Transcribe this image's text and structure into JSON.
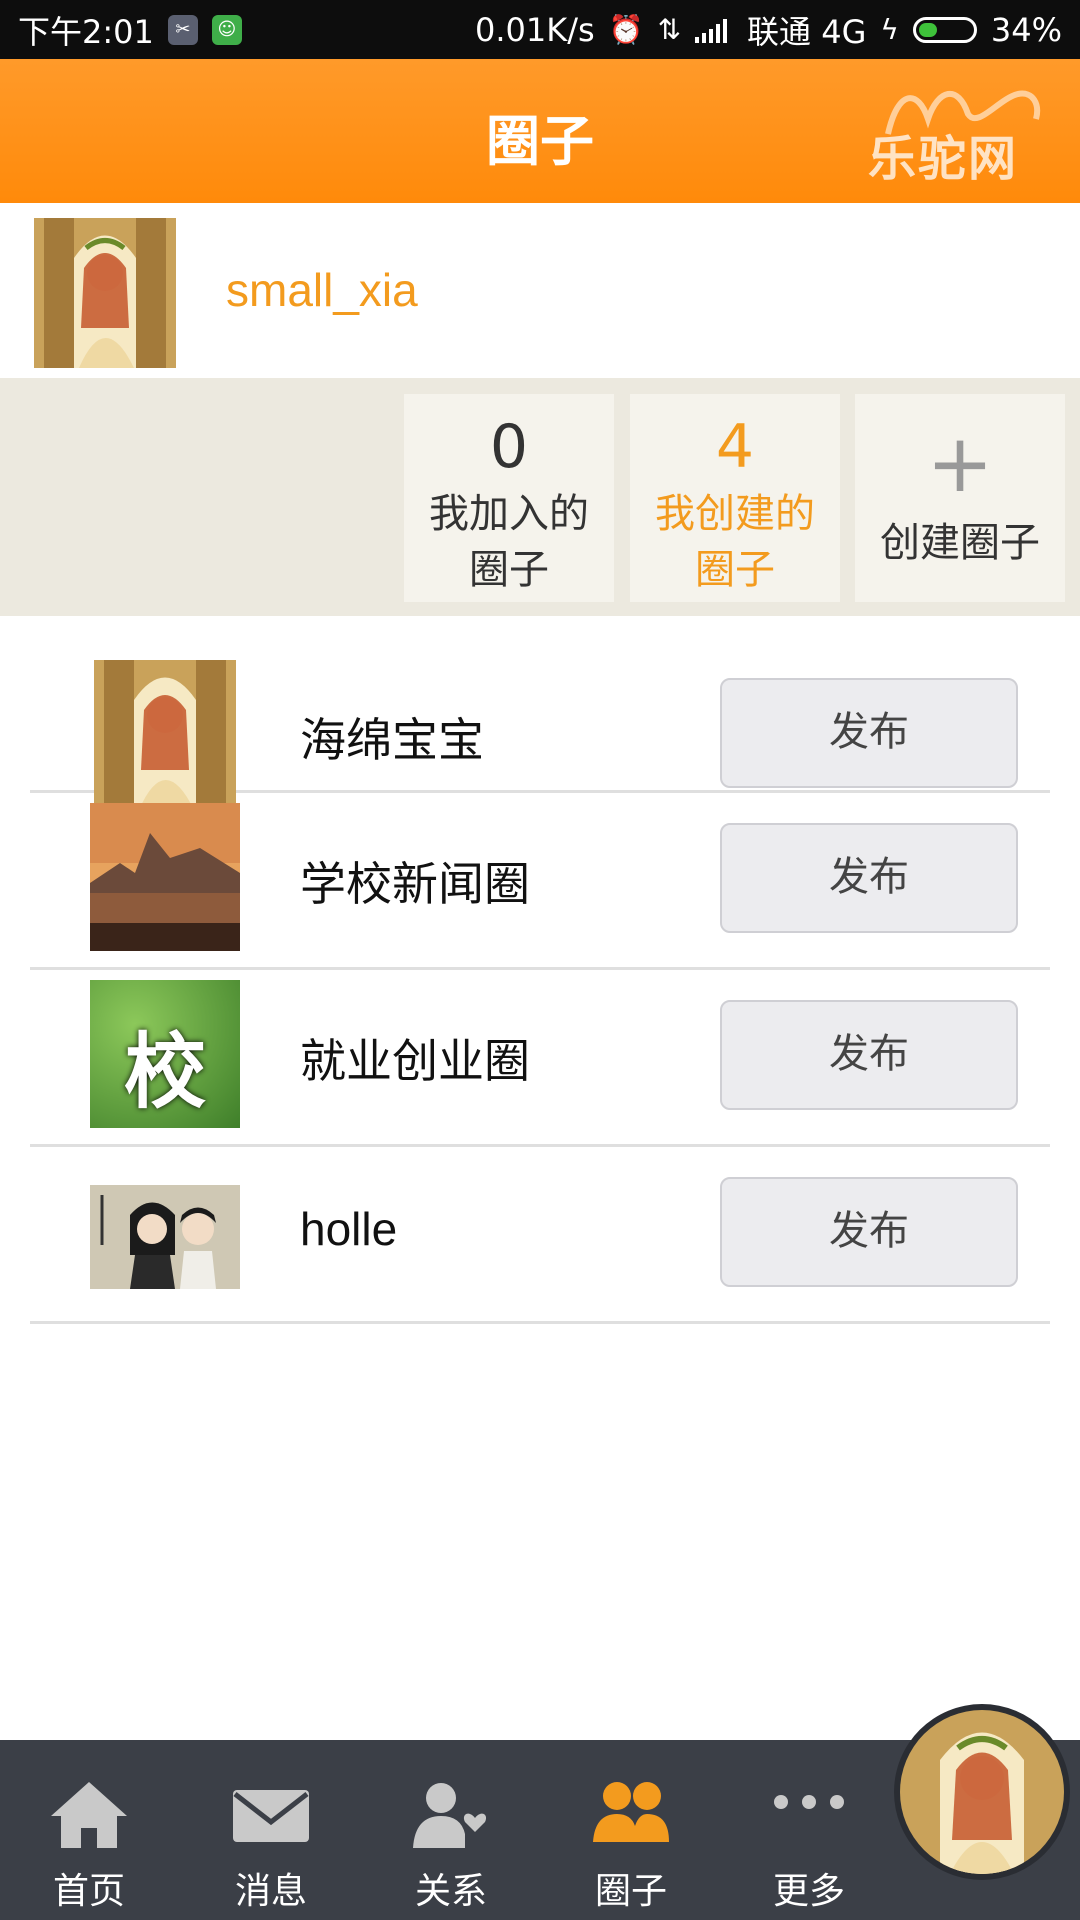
{
  "status_bar": {
    "time": "下午2:01",
    "net_speed": "0.01K/s",
    "carrier": "联通 4G",
    "battery": "34%",
    "battery_level": 0.34
  },
  "header": {
    "title": "圈子",
    "logo_text": "乐驼网"
  },
  "user": {
    "name": "small_xia"
  },
  "stats": [
    {
      "value": "0",
      "label_line1": "我加入的",
      "label_line2": "圈子",
      "active": false
    },
    {
      "value": "4",
      "label_line1": "我创建的",
      "label_line2": "圈子",
      "active": true
    }
  ],
  "create_circle": {
    "plus": "+",
    "label": "创建圈子"
  },
  "circles": [
    {
      "name": "海绵宝宝",
      "action": "发布",
      "thumb": "anime-girl"
    },
    {
      "name": "学校新闻圈",
      "action": "发布",
      "thumb": "sunset"
    },
    {
      "name": "就业创业圈",
      "action": "发布",
      "thumb": "school-char",
      "thumb_char": "校"
    },
    {
      "name": "holle",
      "action": "发布",
      "thumb": "poster"
    }
  ],
  "nav": [
    {
      "label": "首页",
      "icon": "home-icon"
    },
    {
      "label": "消息",
      "icon": "mail-icon"
    },
    {
      "label": "关系",
      "icon": "relation-icon"
    },
    {
      "label": "圈子",
      "icon": "group-icon",
      "active": true
    },
    {
      "label": "更多",
      "icon": "more-icon"
    }
  ],
  "colors": {
    "accent": "#f39b1e",
    "header": "#ff8f12",
    "nav_bg": "#3b3f47"
  }
}
